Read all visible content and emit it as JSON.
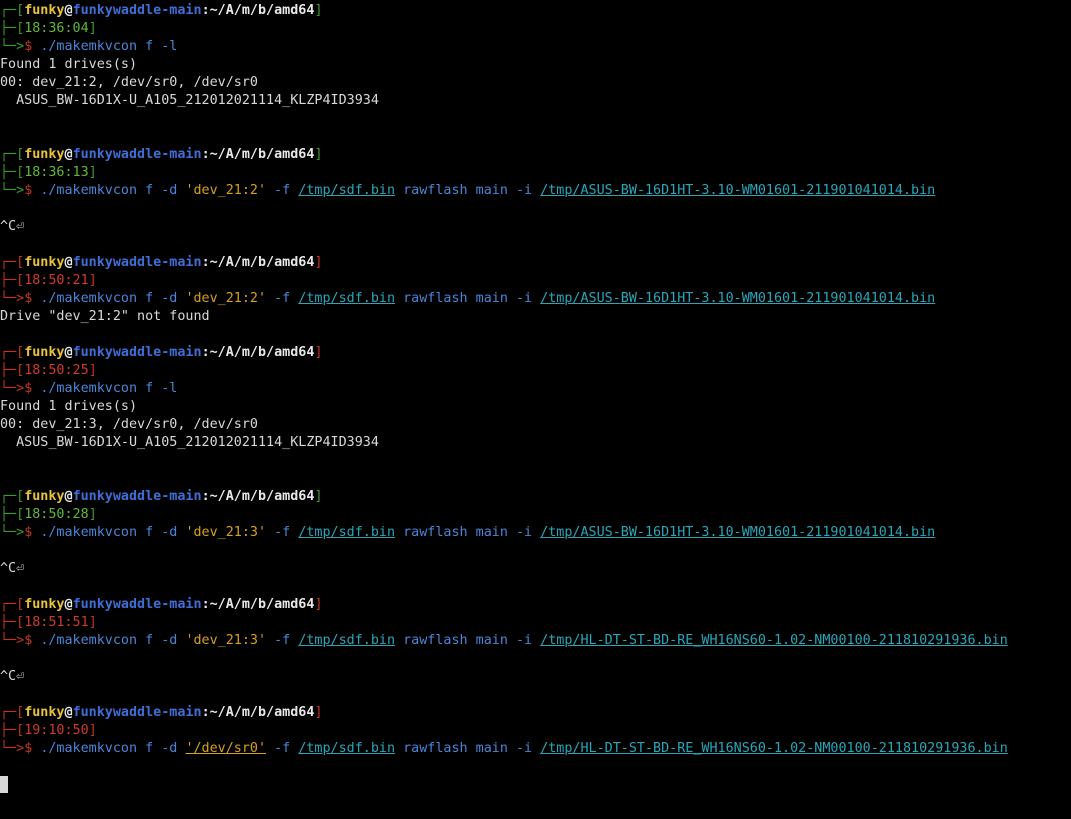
{
  "prompt": {
    "user": "funky",
    "at": "@",
    "host": "funkywaddle-main",
    "sep": ":",
    "path": "~/A/m/b/amd64",
    "frame_top": "┌─[",
    "frame_top_end": "]",
    "frame_mid": "├─[",
    "frame_mid_end": "]",
    "frame_bot": "└─>",
    "dollar": "$ "
  },
  "blocks": [
    {
      "time": "18:36:04",
      "status": "ok",
      "command": "./makemkvcon f -l",
      "output": [
        "Found 1 drives(s)",
        "00: dev_21:2, /dev/sr0, /dev/sr0",
        "  ASUS_BW-16D1X-U_A105_212012021114_KLZP4ID3934",
        "",
        ""
      ]
    },
    {
      "time": "18:36:13",
      "status": "ok",
      "cmd_prefix": "./makemkvcon f -d ",
      "drive": "'dev_21:2'",
      "cmd_mid": " -f ",
      "bin": "/tmp/sdf.bin",
      "cmd_mid2": " rawflash main -i ",
      "fw": "/tmp/ASUS-BW-16D1HT-3.10-WM01601-211901041014.bin",
      "output": [
        "",
        "^C⏎",
        ""
      ]
    },
    {
      "time": "18:50:21",
      "status": "err",
      "cmd_prefix": "./makemkvcon f -d ",
      "drive": "'dev_21:2'",
      "cmd_mid": " -f ",
      "bin": "/tmp/sdf.bin",
      "cmd_mid2": " rawflash main -i ",
      "fw": "/tmp/ASUS-BW-16D1HT-3.10-WM01601-211901041014.bin",
      "output": [
        "Drive \"dev_21:2\" not found",
        ""
      ]
    },
    {
      "time": "18:50:25",
      "status": "err",
      "command": "./makemkvcon f -l",
      "output": [
        "Found 1 drives(s)",
        "00: dev_21:3, /dev/sr0, /dev/sr0",
        "  ASUS_BW-16D1X-U_A105_212012021114_KLZP4ID3934",
        "",
        ""
      ]
    },
    {
      "time": "18:50:28",
      "status": "ok",
      "cmd_prefix": "./makemkvcon f -d ",
      "drive": "'dev_21:3'",
      "cmd_mid": " -f ",
      "bin": "/tmp/sdf.bin",
      "cmd_mid2": " rawflash main -i ",
      "fw": "/tmp/ASUS-BW-16D1HT-3.10-WM01601-211901041014.bin",
      "output": [
        "",
        "^C⏎",
        ""
      ]
    },
    {
      "time": "18:51:51",
      "status": "err",
      "cmd_prefix": "./makemkvcon f -d ",
      "drive": "'dev_21:3'",
      "cmd_mid": " -f ",
      "bin": "/tmp/sdf.bin",
      "cmd_mid2": " rawflash main -i ",
      "fw": "/tmp/HL-DT-ST-BD-RE_WH16NS60-1.02-NM00100-211810291936.bin",
      "output": [
        "",
        "^C⏎",
        ""
      ]
    },
    {
      "time": "19:10:50",
      "status": "err",
      "cmd_prefix": "./makemkvcon f -d ",
      "drive": "'/dev/sr0'",
      "drive_underline": true,
      "cmd_mid": " -f ",
      "bin": "/tmp/sdf.bin",
      "cmd_mid2": " rawflash main -i ",
      "fw": "/tmp/HL-DT-ST-BD-RE_WH16NS60-1.02-NM00100-211810291936.bin",
      "output": [
        ""
      ]
    }
  ],
  "colors": {
    "background": "#000000",
    "frame": "#c23621",
    "user": "#e8c33a",
    "host": "#3f6fd6",
    "time_ok": "#5fb83a",
    "time_err": "#d03a2a",
    "command": "#4a86d8",
    "string": "#d6a01e",
    "file_link": "#2aa6b8"
  }
}
